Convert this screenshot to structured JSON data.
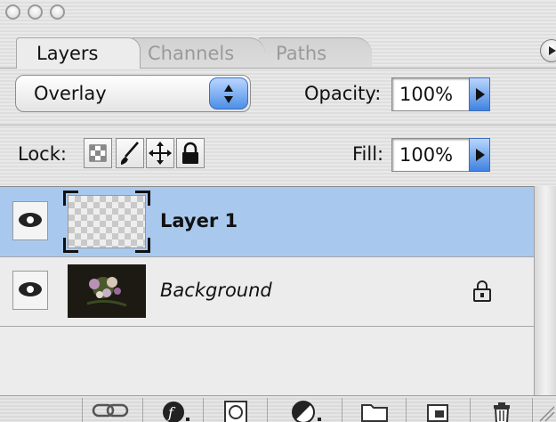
{
  "tabs": [
    "Layers",
    "Channels",
    "Paths"
  ],
  "blend": {
    "mode": "Overlay"
  },
  "opacity": {
    "label": "Opacity:",
    "value": "100%"
  },
  "lock": {
    "label": "Lock:"
  },
  "fill": {
    "label": "Fill:",
    "value": "100%"
  },
  "layers": [
    {
      "name": "Layer 1",
      "selected": true,
      "visible": true
    },
    {
      "name": "Background",
      "selected": false,
      "visible": true,
      "locked": true
    }
  ],
  "icons": [
    "eye-icon",
    "lock-icon",
    "link-icon",
    "layer-style-icon",
    "layer-mask-icon",
    "adjustment-layer-icon",
    "group-folder-icon",
    "new-layer-icon",
    "trash-icon",
    "panel-menu-icon"
  ],
  "colors": {
    "selection": "#a9c8ee",
    "aqua_blue": "#4d8fe6"
  }
}
